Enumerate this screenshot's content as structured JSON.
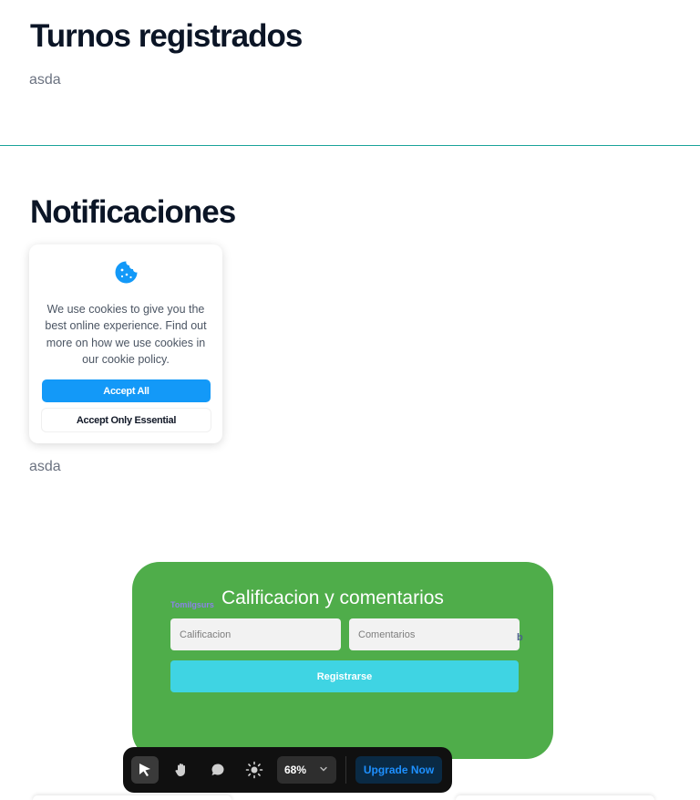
{
  "sections": {
    "turnos": {
      "title": "Turnos registrados",
      "text": "asda"
    },
    "notificaciones": {
      "title": "Notificaciones",
      "text": "asda"
    }
  },
  "cookie_banner": {
    "icon": "cookie-icon",
    "message": "We use cookies to give you the best online experience. Find out more on how we use cookies in our cookie policy.",
    "accept_all": "Accept All",
    "accept_essential": "Accept Only Essential"
  },
  "rating_form": {
    "title": "Calificacion y comentarios",
    "tiny_label": "Tomilgsurs",
    "rating_placeholder": "Calificacion",
    "comments_placeholder": "Comentarios",
    "side_mark": "b",
    "submit_label": "Registrarse"
  },
  "toolbar": {
    "tools": [
      "select-icon",
      "hand-icon",
      "comment-icon",
      "brightness-icon"
    ],
    "zoom": "68%",
    "upgrade_label": "Upgrade Now"
  },
  "colors": {
    "panel_green": "#4fad4a",
    "accent_blue": "#1399f8",
    "submit_cyan": "#3fd4e3",
    "divider_teal": "#1aa39a"
  }
}
